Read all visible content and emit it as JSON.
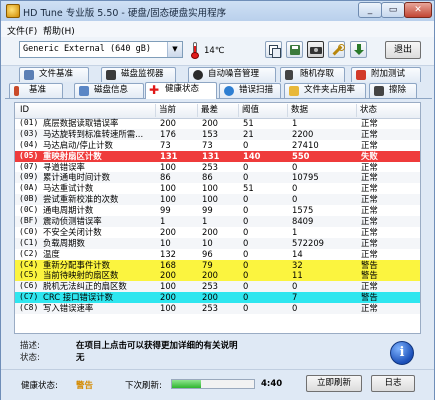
{
  "window": {
    "title": "HD Tune 专业版 5.50 - 硬盘/固态硬盘实用程序"
  },
  "menu": [
    "文件(F)",
    "帮助(H)"
  ],
  "toolbar": {
    "drive": "Generic External (640 gB)",
    "temperature": "14℃",
    "exit_label": "退出"
  },
  "tabs": {
    "row1": [
      "文件基准",
      "磁盘监视器",
      "自动噪音管理",
      "随机存取",
      "附加测试"
    ],
    "row2": [
      "基准",
      "磁盘信息",
      "健康状态",
      "错误扫描",
      "文件夹占用率",
      "擦除"
    ],
    "active": "健康状态"
  },
  "table": {
    "headers": [
      "ID",
      "当前",
      "最差",
      "阈值",
      "数据",
      "状态"
    ],
    "rows": [
      {
        "id": "(01)",
        "name": "底层数据读取错误率",
        "cur": "200",
        "worst": "200",
        "thr": "51",
        "data": "1",
        "status": "正常",
        "hl": ""
      },
      {
        "id": "(03)",
        "name": "马达旋转到标准转速所需...",
        "cur": "176",
        "worst": "153",
        "thr": "21",
        "data": "2200",
        "status": "正常",
        "hl": ""
      },
      {
        "id": "(04)",
        "name": "马达启动/停止计数",
        "cur": "73",
        "worst": "73",
        "thr": "0",
        "data": "27410",
        "status": "正常",
        "hl": ""
      },
      {
        "id": "(05)",
        "name": "重映射扇区计数",
        "cur": "131",
        "worst": "131",
        "thr": "140",
        "data": "550",
        "status": "失败",
        "hl": "red"
      },
      {
        "id": "(07)",
        "name": "寻道错误率",
        "cur": "100",
        "worst": "253",
        "thr": "0",
        "data": "0",
        "status": "正常",
        "hl": ""
      },
      {
        "id": "(09)",
        "name": "累计通电时间计数",
        "cur": "86",
        "worst": "86",
        "thr": "0",
        "data": "10795",
        "status": "正常",
        "hl": ""
      },
      {
        "id": "(0A)",
        "name": "马达重试计数",
        "cur": "100",
        "worst": "100",
        "thr": "51",
        "data": "0",
        "status": "正常",
        "hl": ""
      },
      {
        "id": "(0B)",
        "name": "尝试重新校准的次数",
        "cur": "100",
        "worst": "100",
        "thr": "0",
        "data": "0",
        "status": "正常",
        "hl": ""
      },
      {
        "id": "(0C)",
        "name": "通电周期计数",
        "cur": "99",
        "worst": "99",
        "thr": "0",
        "data": "1575",
        "status": "正常",
        "hl": ""
      },
      {
        "id": "(BF)",
        "name": "震动侦测错误率",
        "cur": "1",
        "worst": "1",
        "thr": "0",
        "data": "8409",
        "status": "正常",
        "hl": ""
      },
      {
        "id": "(C0)",
        "name": "不安全关闭计数",
        "cur": "200",
        "worst": "200",
        "thr": "0",
        "data": "1",
        "status": "正常",
        "hl": ""
      },
      {
        "id": "(C1)",
        "name": "负载周期数",
        "cur": "10",
        "worst": "10",
        "thr": "0",
        "data": "572209",
        "status": "正常",
        "hl": ""
      },
      {
        "id": "(C2)",
        "name": "温度",
        "cur": "132",
        "worst": "96",
        "thr": "0",
        "data": "14",
        "status": "正常",
        "hl": ""
      },
      {
        "id": "(C4)",
        "name": "重新分配事件计数",
        "cur": "168",
        "worst": "79",
        "thr": "0",
        "data": "32",
        "status": "警告",
        "hl": "yellow"
      },
      {
        "id": "(C5)",
        "name": "当前待映射的扇区数",
        "cur": "200",
        "worst": "200",
        "thr": "0",
        "data": "11",
        "status": "警告",
        "hl": "yellow"
      },
      {
        "id": "(C6)",
        "name": "脱机无法纠正的扇区数",
        "cur": "100",
        "worst": "253",
        "thr": "0",
        "data": "0",
        "status": "正常",
        "hl": ""
      },
      {
        "id": "(C7)",
        "name": "CRC 接口错误计数",
        "cur": "200",
        "worst": "200",
        "thr": "0",
        "data": "7",
        "status": "警告",
        "hl": "cyan"
      },
      {
        "id": "(C8)",
        "name": "写入错误速率",
        "cur": "100",
        "worst": "253",
        "thr": "0",
        "data": "0",
        "status": "正常",
        "hl": ""
      }
    ]
  },
  "description": {
    "desc_label": "描述:",
    "desc_text": "在项目上点击可以获得更加详细的有关说明",
    "state_label": "状态:",
    "state_text": "无"
  },
  "statusbar": {
    "health_label": "健康状态:",
    "health_value": "警告",
    "next_refresh_label": "下次刷新:",
    "countdown": "4:40",
    "refresh_fraction": 0.35,
    "refresh_button": "立即刷新",
    "log_button": "日志"
  },
  "colors": {
    "fail_row": "#ef3b3b",
    "warn_row": "#fbf43f",
    "crc_row": "#2fe6ef",
    "warn_text": "#d48a00"
  }
}
